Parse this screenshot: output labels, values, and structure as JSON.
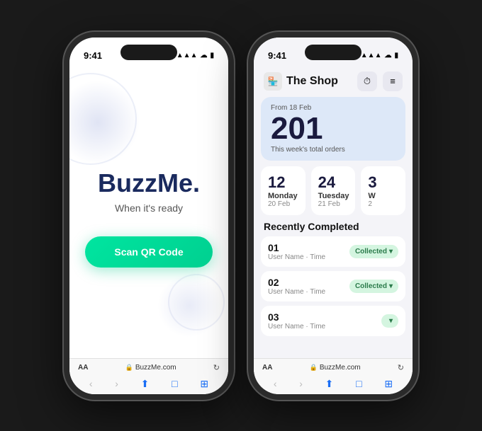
{
  "left_phone": {
    "status_time": "9:41",
    "app_title": "BuzzMe.",
    "app_subtitle": "When it's ready",
    "scan_button": "Scan QR Code",
    "browser_url": "BuzzMe.com",
    "browser_aa": "AA"
  },
  "right_phone": {
    "status_time": "9:41",
    "shop_name": "The Shop",
    "stats_from": "From 18 Feb",
    "stats_number": "201",
    "stats_desc": "This week's total orders",
    "days": [
      {
        "number": "12",
        "day": "Monday",
        "date": "20 Feb"
      },
      {
        "number": "24",
        "day": "Tuesday",
        "date": "21 Feb"
      },
      {
        "number": "3",
        "day": "W",
        "date": "2"
      }
    ],
    "section_title": "Recently Completed",
    "orders": [
      {
        "number": "01",
        "meta": "User Name · Time",
        "badge": "Collected"
      },
      {
        "number": "02",
        "meta": "User Name · Time",
        "badge": "Collected"
      },
      {
        "number": "03",
        "meta": "User Name · Time",
        "badge": ""
      }
    ],
    "browser_url": "BuzzMe.com",
    "browser_aa": "AA"
  },
  "icons": {
    "signal": "▲▲▲",
    "wifi": "⊙",
    "battery": "▮",
    "lock": "🔒",
    "reload": "↻",
    "back": "‹",
    "forward": "›",
    "share": "⬆",
    "book": "□",
    "tabs": "⊞",
    "clock": "⏱",
    "menu": "≡",
    "chevron_down": "▾"
  }
}
